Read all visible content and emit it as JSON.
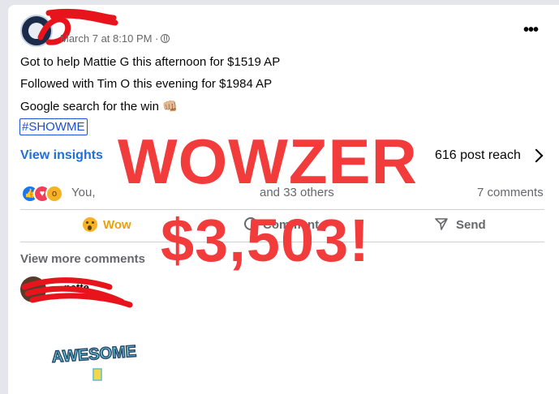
{
  "post": {
    "timestamp": "March 7 at 8:10 PM ·",
    "more_icon": "more-horizontal-icon",
    "lines": [
      "Got to help Mattie G this afternoon for $1519 AP",
      "Followed with Tim O this evening for $1984 AP",
      "Google search for the win 👊🏼"
    ],
    "hashtag": "#SHOWME"
  },
  "insights": {
    "link": "View insights",
    "reach": "616 post reach"
  },
  "reactions": {
    "icons": [
      "like-icon",
      "love-icon",
      "wow-icon"
    ],
    "you": "You,",
    "others": "and 33 others",
    "comments": "7 comments"
  },
  "actions": {
    "wow": "Wow",
    "comment": "Comment",
    "send": "Send"
  },
  "comments_section": {
    "view_more": "View more comments",
    "commenter_name": "...nette",
    "sticker_text": "AWESOME"
  },
  "overlay": {
    "line1": "WOWZER",
    "line2": "$3,503!"
  },
  "colors": {
    "overlay_red": "#f23b3b",
    "link_blue": "#216fdb",
    "wow_gold": "#e8a30c",
    "scribble_red": "#e8141b"
  }
}
